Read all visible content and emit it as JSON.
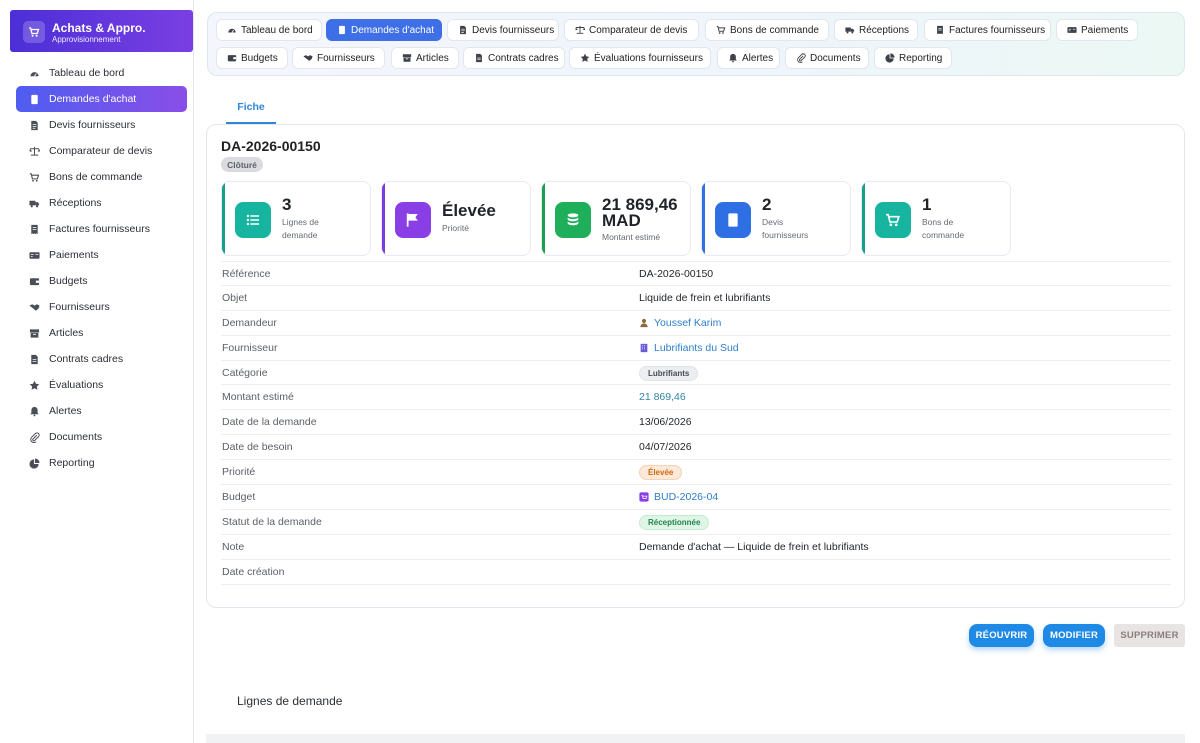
{
  "brand": {
    "title": "Achats & Appro.",
    "subtitle": "Approvisionnement",
    "icon": "cart-icon"
  },
  "sidebar": {
    "items": [
      {
        "label": "Tableau de bord",
        "icon": "dashboard-icon",
        "active": false
      },
      {
        "label": "Demandes d'achat",
        "icon": "document-icon",
        "active": true
      },
      {
        "label": "Devis fournisseurs",
        "icon": "quote-icon",
        "active": false
      },
      {
        "label": "Comparateur de devis",
        "icon": "balance-icon",
        "active": false
      },
      {
        "label": "Bons de commande",
        "icon": "cart-icon",
        "active": false
      },
      {
        "label": "Réceptions",
        "icon": "truck-icon",
        "active": false
      },
      {
        "label": "Factures fournisseurs",
        "icon": "invoice-icon",
        "active": false
      },
      {
        "label": "Paiements",
        "icon": "money-icon",
        "active": false
      },
      {
        "label": "Budgets",
        "icon": "wallet-icon",
        "active": false
      },
      {
        "label": "Fournisseurs",
        "icon": "handshake-icon",
        "active": false
      },
      {
        "label": "Articles",
        "icon": "boxes-icon",
        "active": false
      },
      {
        "label": "Contrats cadres",
        "icon": "contract-icon",
        "active": false
      },
      {
        "label": "Évaluations",
        "icon": "star-icon",
        "active": false
      },
      {
        "label": "Alertes",
        "icon": "bell-icon",
        "active": false
      },
      {
        "label": "Documents",
        "icon": "paperclip-icon",
        "active": false
      },
      {
        "label": "Reporting",
        "icon": "pie-icon",
        "active": false
      }
    ]
  },
  "topnav": {
    "row1": [
      {
        "label": "Tableau de bord",
        "icon": "dashboard-icon",
        "active": false
      },
      {
        "label": "Demandes d'achat",
        "icon": "document-icon",
        "active": true
      },
      {
        "label": "Devis fournisseurs",
        "icon": "quote-icon",
        "active": false
      },
      {
        "label": "Comparateur de devis",
        "icon": "balance-icon",
        "active": false
      },
      {
        "label": "Bons de commande",
        "icon": "cart-icon",
        "active": false
      },
      {
        "label": "Réceptions",
        "icon": "truck-icon",
        "active": false
      },
      {
        "label": "Factures fournisseurs",
        "icon": "invoice-icon",
        "active": false
      },
      {
        "label": "Paiements",
        "icon": "money-icon",
        "active": false
      }
    ],
    "row2": [
      {
        "label": "Budgets",
        "icon": "wallet-icon",
        "active": false
      },
      {
        "label": "Fournisseurs",
        "icon": "handshake-icon",
        "active": false
      },
      {
        "label": "Articles",
        "icon": "boxes-icon",
        "active": false
      },
      {
        "label": "Contrats cadres",
        "icon": "contract-icon",
        "active": false
      },
      {
        "label": "Évaluations fournisseurs",
        "icon": "star-icon",
        "active": false
      },
      {
        "label": "Alertes",
        "icon": "bell-icon",
        "active": false
      },
      {
        "label": "Documents",
        "icon": "paperclip-icon",
        "active": false
      },
      {
        "label": "Reporting",
        "icon": "pie-icon",
        "active": false
      }
    ]
  },
  "tabs": {
    "fiche": "Fiche"
  },
  "record": {
    "reference": "DA-2026-00150",
    "status": "Clôturé"
  },
  "stats": [
    {
      "value": "3",
      "label1": "Lignes de",
      "label2": "demande",
      "icon": "list-icon",
      "color": "#17b5a0",
      "bar": "#14a08d"
    },
    {
      "value": "Élevée",
      "label1": "Priorité",
      "label2": "",
      "icon": "flag-icon",
      "color": "#8a3fe6",
      "bar": "#7c3be0"
    },
    {
      "value": "21 869,46",
      "value2": "MAD",
      "label1": "Montant estimé",
      "label2": "",
      "icon": "coins-icon",
      "color": "#1fae5a",
      "bar": "#1a9e52"
    },
    {
      "value": "2",
      "label1": "Devis",
      "label2": "fournisseurs",
      "icon": "document-icon",
      "color": "#2f6fe4",
      "bar": "#2f6fe4"
    },
    {
      "value": "1",
      "label1": "Bons de",
      "label2": "commande",
      "icon": "cart-icon",
      "color": "#17b5a0",
      "bar": "#14a08d"
    }
  ],
  "details": [
    {
      "label": "Référence",
      "value": "DA-2026-00150",
      "type": "text"
    },
    {
      "label": "Objet",
      "value": "Liquide de frein et lubrifiants",
      "type": "text"
    },
    {
      "label": "Demandeur",
      "value": "Youssef Karim",
      "type": "link",
      "icon": "user-icon"
    },
    {
      "label": "Fournisseur",
      "value": "Lubrifiants du Sud",
      "type": "link",
      "icon": "building-icon"
    },
    {
      "label": "Catégorie",
      "value": "Lubrifiants",
      "type": "chip-gray"
    },
    {
      "label": "Montant estimé",
      "value": "21 869,46",
      "type": "money"
    },
    {
      "label": "Date de la demande",
      "value": "13/06/2026",
      "type": "text"
    },
    {
      "label": "Date de besoin",
      "value": "04/07/2026",
      "type": "text"
    },
    {
      "label": "Priorité",
      "value": "Élevée",
      "type": "chip-orange"
    },
    {
      "label": "Budget",
      "value": "BUD-2026-04",
      "type": "link",
      "icon": "budget-icon"
    },
    {
      "label": "Statut de la demande",
      "value": "Réceptionnée",
      "type": "chip-green"
    },
    {
      "label": "Note",
      "value": "Demande d'achat — Liquide de frein et lubrifiants",
      "type": "text"
    },
    {
      "label": "Date création",
      "value": "",
      "type": "text"
    }
  ],
  "actions": {
    "reopen": "RÉOUVRIR",
    "edit": "MODIFIER",
    "delete": "SUPPRIMER"
  },
  "sections": {
    "lines_title": "Lignes de demande"
  }
}
